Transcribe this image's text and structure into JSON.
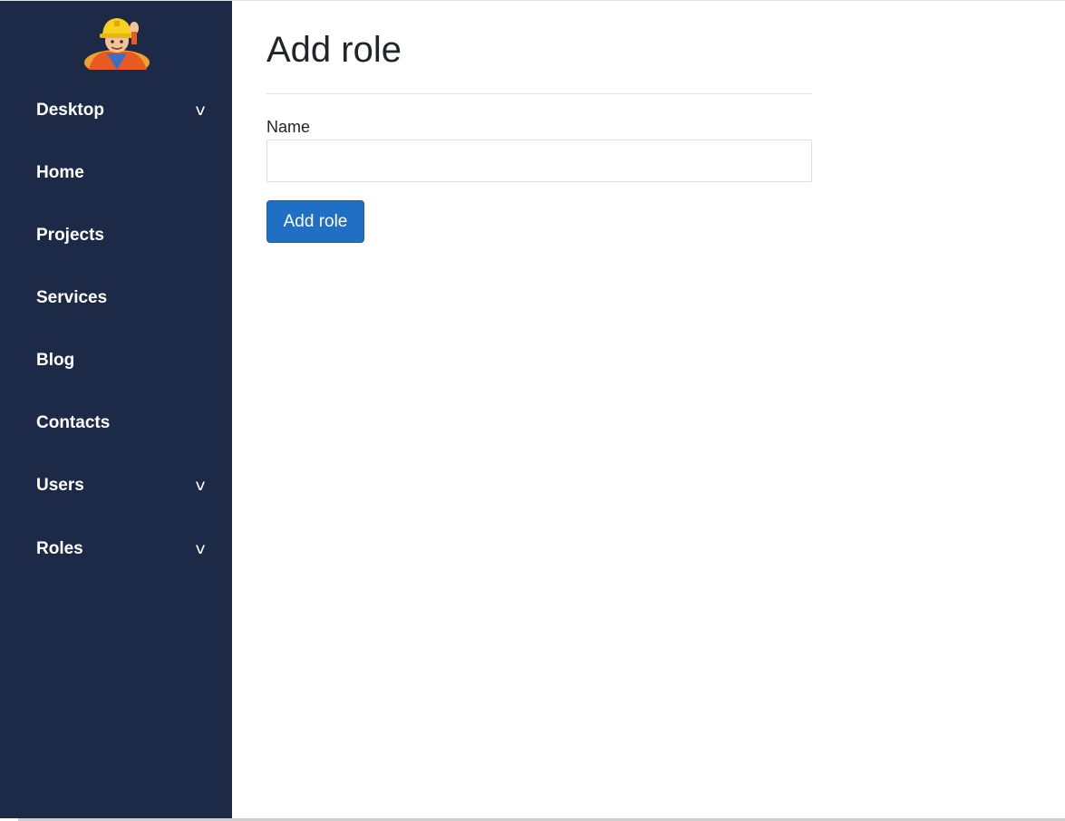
{
  "sidebar": {
    "items": [
      {
        "label": "Desktop",
        "chevron": "v"
      },
      {
        "label": "Home"
      },
      {
        "label": "Projects"
      },
      {
        "label": "Services"
      },
      {
        "label": "Blog"
      },
      {
        "label": "Contacts"
      },
      {
        "label": "Users",
        "chevron": "v"
      },
      {
        "label": "Roles",
        "chevron": "v"
      }
    ]
  },
  "main": {
    "title": "Add role",
    "form": {
      "name_label": "Name",
      "name_value": "",
      "submit_label": "Add role"
    }
  },
  "colors": {
    "sidebar_bg": "#1c2a48",
    "primary_button": "#1f6fc4"
  }
}
